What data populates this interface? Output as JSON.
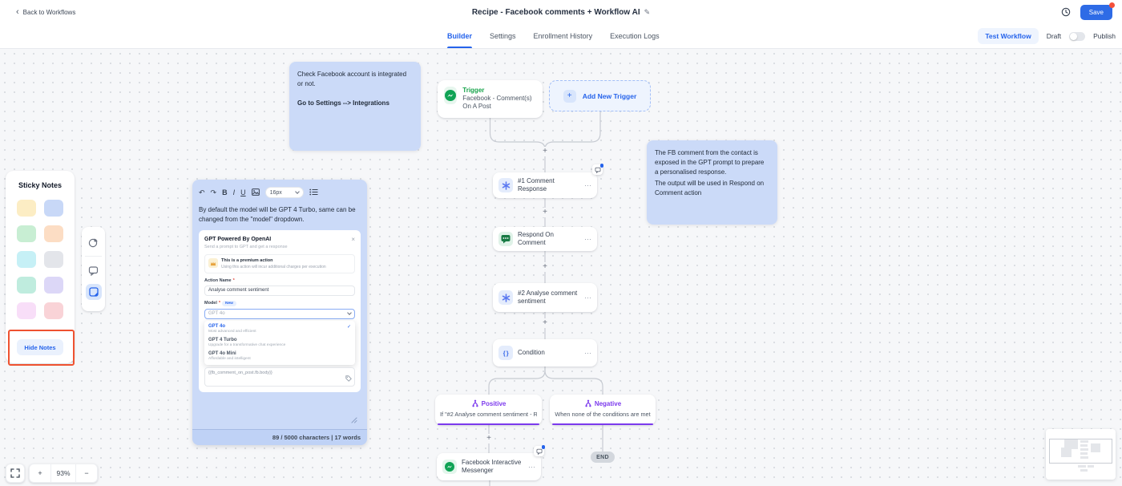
{
  "icons": {
    "back": "‹",
    "edit": "✎",
    "plus": "+",
    "minus": "−",
    "more": "⋯",
    "close": "×",
    "check": "✓",
    "undo": "↶",
    "redo": "↷",
    "bold": "B",
    "italic": "I",
    "underline": "U",
    "braces": "{ }"
  },
  "header": {
    "back_label": "Back to Workflows",
    "title": "Recipe - Facebook comments + Workflow AI",
    "save_label": "Save",
    "tabs": {
      "builder": "Builder",
      "settings": "Settings",
      "enrollment_history": "Enrollment History",
      "execution_logs": "Execution Logs"
    },
    "test_workflow_label": "Test Workflow",
    "draft_label": "Draft",
    "publish_label": "Publish"
  },
  "workflow": {
    "trigger_card": {
      "label": "Trigger",
      "name": "Facebook - Comment(s) On A Post"
    },
    "add_new_trigger_label": "Add New Trigger",
    "node_comment_response": "#1 Comment Response",
    "node_respond_on_comment": "Respond On Comment",
    "node_analyse_sentiment": "#2 Analyse comment sentiment",
    "node_condition": "Condition",
    "branch_positive": {
      "label": "Positive",
      "rule": "If \"#2 Analyse comment sentiment - R..."
    },
    "branch_negative": {
      "label": "Negative",
      "rule": "When none of the conditions are met"
    },
    "node_messenger": "Facebook Interactive Messenger",
    "end_label": "END"
  },
  "notes": {
    "integration_note": {
      "line1": "Check Facebook account is integrated or not.",
      "line2": "Go to Settings --> Integrations"
    },
    "gpt_note": {
      "line1": "The FB comment from the contact is exposed in the GPT prompt to prepare a personalised response.",
      "line2": "The output will be used in Respond on Comment action"
    }
  },
  "sticky_panel": {
    "title": "Sticky Notes",
    "hide_button_label": "Hide Notes",
    "colors": [
      "#fcedc4",
      "#c8d8f7",
      "#c8eed3",
      "#fcddc4",
      "#c6f0f6",
      "#e3e5ea",
      "#bfecde",
      "#dcd7f7",
      "#f8def8",
      "#f9d3d7"
    ]
  },
  "editor_note": {
    "font_size_value": "16px",
    "body_text": "By default the model will be GPT 4 Turbo, same can be changed from the \"model\" dropdown.",
    "footer_text": "89 / 5000 characters | 17 words",
    "screenshot": {
      "title": "GPT Powered By OpenAI",
      "subtitle": "Send a prompt to GPT and get a response",
      "premium_title": "This is a premium action",
      "premium_subtitle": "Using this action will incur additional charges per execution",
      "action_name_label": "Action Name",
      "required_mark": "*",
      "action_name_value": "Analyse comment sentiment",
      "model_label": "Model",
      "model_new_badge": "New",
      "model_value": "GPT 4o",
      "options": [
        {
          "name": "GPT 4o",
          "desc": "Most advanced and efficient"
        },
        {
          "name": "GPT 4 Turbo",
          "desc": "Upgrade for a transformative chat experience"
        },
        {
          "name": "GPT 4o Mini",
          "desc": "Affordable and intelligent"
        }
      ],
      "prompt_value": "{{fb_comment_on_post.fb.body}}"
    }
  },
  "controls": {
    "zoom_level": "93%"
  }
}
